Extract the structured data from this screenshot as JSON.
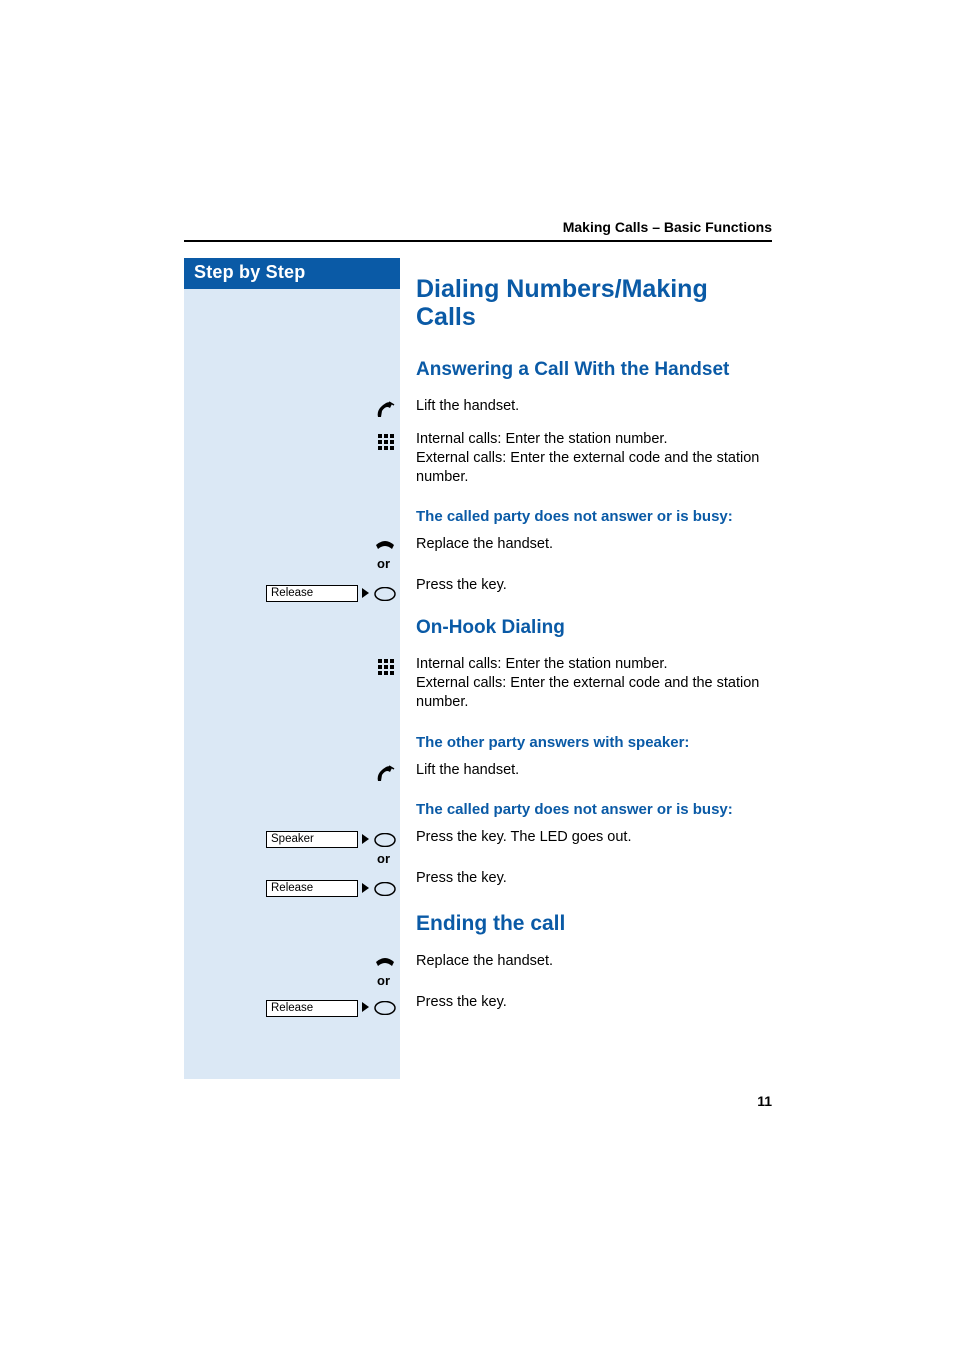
{
  "running_header": "Making Calls – Basic Functions",
  "sidebar": {
    "title": "Step by Step"
  },
  "page_number": "11",
  "sections": {
    "title": "Dialing Numbers/Making Calls",
    "answering": {
      "heading": "Answering a Call With the Handset",
      "lift": "Lift the handset.",
      "internal_external": "Internal calls: Enter the station number.\nExternal calls: Enter the external code and the station number.",
      "no_answer_heading": "The called party does not answer or is busy:",
      "replace": "Replace the handset.",
      "or": "or",
      "release_key": "Release",
      "press_key": "Press the key."
    },
    "onhook": {
      "heading": "On-Hook Dialing",
      "internal_external": "Internal calls: Enter the station number.\nExternal calls: Enter the external code and the station number.",
      "other_party_heading": "The other party answers with speaker:",
      "lift": "Lift the handset.",
      "no_answer_heading": "The called party does not answer or is busy:",
      "speaker_key": "Speaker",
      "press_key_led": "Press the key. The LED goes out.",
      "or": "or",
      "release_key": "Release",
      "press_key": "Press the key."
    },
    "ending": {
      "heading": "Ending the call",
      "replace": "Replace the handset.",
      "or": "or",
      "release_key": "Release",
      "press_key": "Press the key."
    }
  }
}
